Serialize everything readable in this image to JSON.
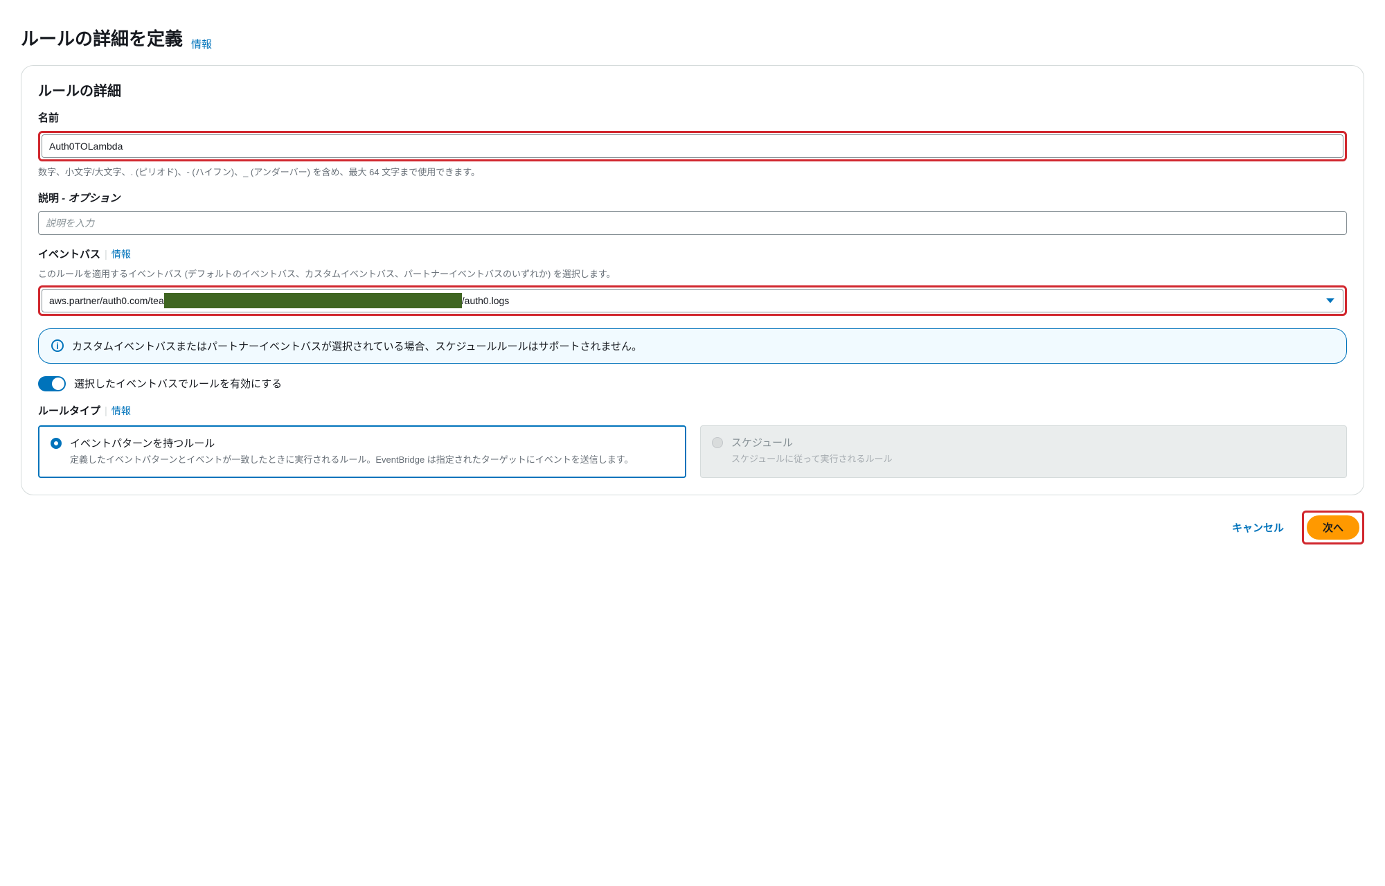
{
  "page": {
    "title": "ルールの詳細を定義",
    "info_link": "情報"
  },
  "panel": {
    "title": "ルールの詳細"
  },
  "name_field": {
    "label": "名前",
    "value": "Auth0TOLambda",
    "help": "数字、小文字/大文字、. (ピリオド)、- (ハイフン)、_ (アンダーバー) を含め、最大 64 文字まで使用できます。"
  },
  "desc_field": {
    "label": "説明",
    "optional": " - オプション",
    "placeholder": "説明を入力"
  },
  "bus_field": {
    "label": "イベントバス",
    "info": "情報",
    "desc": "このルールを適用するイベントバス (デフォルトのイベントバス、カスタムイベントバス、パートナーイベントバスのいずれか) を選択します。",
    "value_prefix": "aws.partner/auth0.com/tea",
    "value_suffix": "/auth0.logs"
  },
  "alert": {
    "text": "カスタムイベントバスまたはパートナーイベントバスが選択されている場合、スケジュールルールはサポートされません。"
  },
  "toggle": {
    "label": "選択したイベントバスでルールを有効にする"
  },
  "rule_type": {
    "label": "ルールタイプ",
    "info": "情報",
    "option_pattern": {
      "title": "イベントパターンを持つルール",
      "desc": "定義したイベントパターンとイベントが一致したときに実行されるルール。EventBridge は指定されたターゲットにイベントを送信します。"
    },
    "option_schedule": {
      "title": "スケジュール",
      "desc": "スケジュールに従って実行されるルール"
    }
  },
  "footer": {
    "cancel": "キャンセル",
    "next": "次へ"
  }
}
